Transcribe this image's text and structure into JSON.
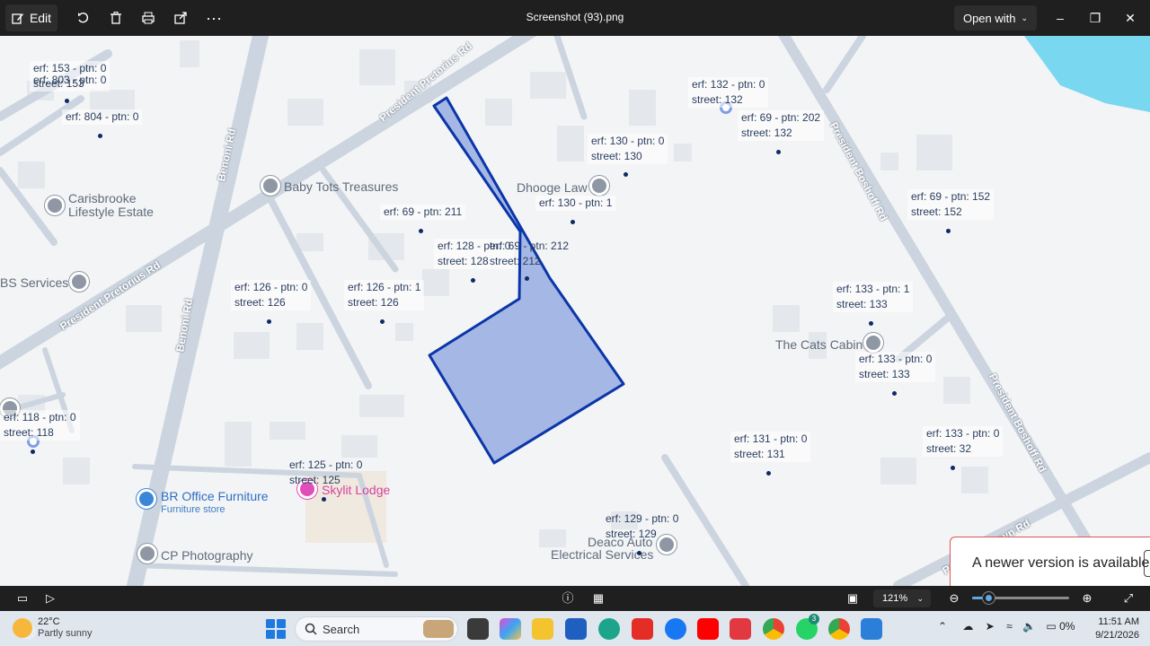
{
  "toolbar": {
    "edit_label": "Edit",
    "title": "Screenshot (93).png",
    "open_with_label": "Open with",
    "icons": [
      "rotate-icon",
      "delete-icon",
      "print-icon",
      "share-icon",
      "more-icon"
    ]
  },
  "map": {
    "parcel_labels": [
      {
        "erf": "erf: 153 - ptn: 0",
        "street": "street: 153"
      },
      {
        "erf": "erf: 803 - ptn: 0",
        "street": ""
      },
      {
        "erf": "erf: 804 - ptn: 0",
        "street": ""
      },
      {
        "erf": "erf: 132 - ptn: 0",
        "street": "street: 132"
      },
      {
        "erf": "erf: 69 - ptn: 202",
        "street": "street: 132"
      },
      {
        "erf": "erf: 130 - ptn: 0",
        "street": "street: 130"
      },
      {
        "erf": "erf: 130 - ptn: 1",
        "street": ""
      },
      {
        "erf": "erf: 69 - ptn: 211",
        "street": ""
      },
      {
        "erf": "erf: 128 - ptn: 0",
        "street": "street: 128"
      },
      {
        "erf": "erf: 69 - ptn: 212",
        "street": "street: 212"
      },
      {
        "erf": "erf: 69 - ptn: 152",
        "street": "street: 152"
      },
      {
        "erf": "erf: 126 - ptn: 0",
        "street": "street: 126"
      },
      {
        "erf": "erf: 126 - ptn: 1",
        "street": "street: 126"
      },
      {
        "erf": "erf: 133 - ptn: 1",
        "street": "street: 133"
      },
      {
        "erf": "erf: 133 - ptn: 0",
        "street": "street: 133"
      },
      {
        "erf": "erf: 118 - ptn: 0",
        "street": "street: 118"
      },
      {
        "erf": "erf: 131 - ptn: 0",
        "street": "street: 131"
      },
      {
        "erf": "erf: 133 - ptn: 0",
        "street": "street: 32"
      },
      {
        "erf": "erf: 125 - ptn: 0",
        "street": "street: 125"
      },
      {
        "erf": "erf: 129 - ptn: 0",
        "street": "street: 129"
      }
    ],
    "roads": {
      "pretorius_top": "President Pretorius Rd",
      "pretorius_left": "President Pretorius Rd",
      "benoni_top": "Benoni Rd",
      "benoni_bottom": "Benoni Rd",
      "boshoff_top": "President Boshoff Rd",
      "boshoff_bottom": "President Boshoff Rd",
      "steyn": "President Steyn Rd"
    },
    "places": {
      "baby_tots": "Baby Tots Treasures",
      "dhooge": "Dhooge Law",
      "carisbrooke_1": "Carisbrooke",
      "carisbrooke_2": "Lifestyle Estate",
      "bs_services": "BS Services",
      "cats_cabin": "The Cats Cabin",
      "skylit": "Skylit Lodge",
      "br_office": "BR Office Furniture",
      "br_office_sub": "Furniture store",
      "cp_photo": "CP Photography",
      "deaco_1": "Deaco Auto",
      "deaco_2": "Electrical Services"
    },
    "update_message": "A newer version is available."
  },
  "bottombar": {
    "zoom_label": "121%",
    "zoom_level": 0.17
  },
  "taskbar": {
    "temperature": "22°C",
    "weather": "Partly sunny",
    "search_label": "Search",
    "whatsapp_badge": "3",
    "battery": "0%",
    "time": "11:51 AM",
    "date": "9/21/2026"
  },
  "colors": {
    "parcel_fill": "#9fb3e4",
    "parcel_stroke": "#0b35a8",
    "road": "#c9d2dc",
    "water": "#79d7f0"
  }
}
